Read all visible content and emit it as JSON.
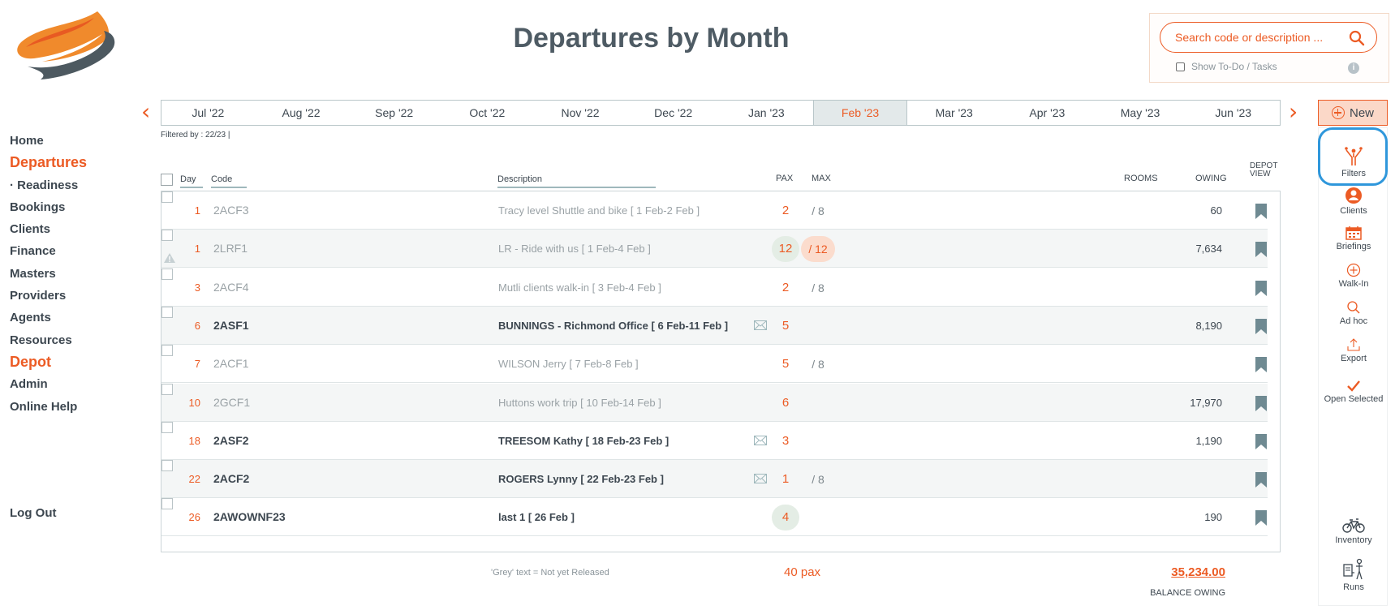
{
  "page_title": "Departures by Month",
  "search": {
    "placeholder": "Search code or description ...",
    "show_todo_label": "Show To-Do / Tasks"
  },
  "nav": {
    "items": [
      "Home",
      "Departures",
      "· Readiness",
      "Bookings",
      "Clients",
      "Finance",
      "Masters",
      "Providers",
      "Agents",
      "Resources",
      "Depot",
      "Admin",
      "Online Help"
    ],
    "logout": "Log Out"
  },
  "months": [
    "Jul '22",
    "Aug '22",
    "Sep '22",
    "Oct '22",
    "Nov '22",
    "Dec '22",
    "Jan '23",
    "Feb '23",
    "Mar '23",
    "Apr '23",
    "May '23",
    "Jun '23"
  ],
  "active_month": "Feb '23",
  "filtered_by": "Filtered by : 22/23 |",
  "new_button": "New",
  "tools": {
    "filters": "Filters",
    "clients": "Clients",
    "briefings": "Briefings",
    "walkin": "Walk-In",
    "adhoc": "Ad hoc",
    "export": "Export",
    "open_selected": "Open Selected",
    "inventory": "Inventory",
    "runs": "Runs"
  },
  "table": {
    "headers": {
      "day": "Day",
      "code": "Code",
      "description": "Description",
      "pax": "PAX",
      "max": "MAX",
      "rooms": "ROOMS",
      "owing": "OWING",
      "depot_view": "DEPOT VIEW"
    },
    "rows": [
      {
        "day": "1",
        "code": "2ACF3",
        "description": "Tracy level Shuttle and bike   [ 1 Feb-2 Feb ]",
        "pax": "2",
        "max": "/ 8",
        "owing": "60"
      },
      {
        "day": "1",
        "code": "2LRF1",
        "description": "LR - Ride with us  [ 1 Feb-4 Feb ]",
        "pax": "12",
        "max": "/ 12",
        "owing": "7,634"
      },
      {
        "day": "3",
        "code": "2ACF4",
        "description": "Mutli clients walk-in  [ 3 Feb-4 Feb ]",
        "pax": "2",
        "max": "/ 8",
        "owing": ""
      },
      {
        "day": "6",
        "code": "2ASF1",
        "description": "BUNNINGS - Richmond Office  [ 6 Feb-11 Feb ]",
        "pax": "5",
        "max": "",
        "owing": "8,190"
      },
      {
        "day": "7",
        "code": "2ACF1",
        "description": "WILSON Jerry  [ 7 Feb-8 Feb ]",
        "pax": "5",
        "max": "/ 8",
        "owing": ""
      },
      {
        "day": "10",
        "code": "2GCF1",
        "description": "Huttons work trip  [ 10 Feb-14 Feb ]",
        "pax": "6",
        "max": "",
        "owing": "17,970"
      },
      {
        "day": "18",
        "code": "2ASF2",
        "description": "TREESOM Kathy  [ 18 Feb-23 Feb ]",
        "pax": "3",
        "max": "",
        "owing": "1,190"
      },
      {
        "day": "22",
        "code": "2ACF2",
        "description": "ROGERS Lynny  [ 22 Feb-23 Feb ]",
        "pax": "1",
        "max": "/ 8",
        "owing": ""
      },
      {
        "day": "26",
        "code": "2AWOWNF23",
        "description": "last 1  [ 26 Feb ]",
        "pax": "4",
        "max": "",
        "owing": "190"
      }
    ]
  },
  "footer": {
    "grey_note": "'Grey' text = Not yet Released",
    "total_pax": "40 pax",
    "balance": "35,234.00",
    "balance_label": "BALANCE OWING"
  },
  "colors": {
    "accent": "#ec5b24",
    "text": "#3d4750",
    "highlight": "#2f97db"
  }
}
